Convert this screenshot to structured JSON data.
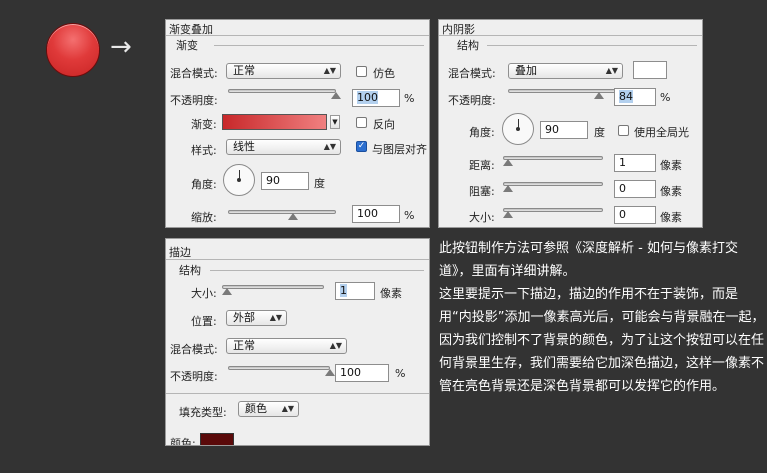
{
  "colors": {
    "background": "#333333",
    "button_red": "#e03a3a",
    "gradient_start": "#c8282a",
    "gradient_end": "#f08080",
    "stroke_color": "#5a0a0a",
    "inner_shadow_swatch": "#ffffff"
  },
  "arrow": "→",
  "gradient_overlay": {
    "title": "渐变叠加",
    "section": "渐变",
    "blend_mode_label": "混合模式:",
    "blend_mode_value": "正常",
    "dither_label": "仿色",
    "opacity_label": "不透明度:",
    "opacity_value": "100",
    "opacity_level": 100,
    "percent": "%",
    "gradient_label": "渐变:",
    "reverse_label": "反向",
    "style_label": "样式:",
    "style_value": "线性",
    "align_label": "与图层对齐",
    "align_checked": true,
    "angle_label": "角度:",
    "angle_value": "90",
    "degree": "度",
    "scale_label": "缩放:",
    "scale_value": "100",
    "scale_level": 100
  },
  "inner_shadow": {
    "title": "内阴影",
    "section": "结构",
    "blend_mode_label": "混合模式:",
    "blend_mode_value": "叠加",
    "opacity_label": "不透明度:",
    "opacity_value": "84",
    "opacity_level": 84,
    "percent": "%",
    "angle_label": "角度:",
    "angle_value": "90",
    "degree": "度",
    "global_light_label": "使用全局光",
    "distance_label": "距离:",
    "distance_value": "1",
    "choke_label": "阻塞:",
    "choke_value": "0",
    "size_label": "大小:",
    "size_value": "0",
    "px": "像素"
  },
  "stroke": {
    "title": "描边",
    "section": "结构",
    "size_label": "大小:",
    "size_value": "1",
    "px": "像素",
    "position_label": "位置:",
    "position_value": "外部",
    "blend_mode_label": "混合模式:",
    "blend_mode_value": "正常",
    "opacity_label": "不透明度:",
    "opacity_value": "100",
    "opacity_level": 100,
    "percent": "%",
    "fill_type_label": "填充类型:",
    "fill_type_value": "颜色",
    "color_label": "颜色:"
  },
  "note": {
    "p1": "此按钮制作方法可参照《深度解析 - 如何与像素打交道》，里面有详细讲解。",
    "p2": "这里要提示一下描边，描边的作用不在于装饰，而是用“内投影”添加一像素高光后，可能会与背景融在一起，因为我们控制不了背景的颜色，为了让这个按钮可以在任何背景里生存，我们需要给它加深色描边，这样一像素不管在亮色背景还是深色背景都可以发挥它的作用。"
  }
}
